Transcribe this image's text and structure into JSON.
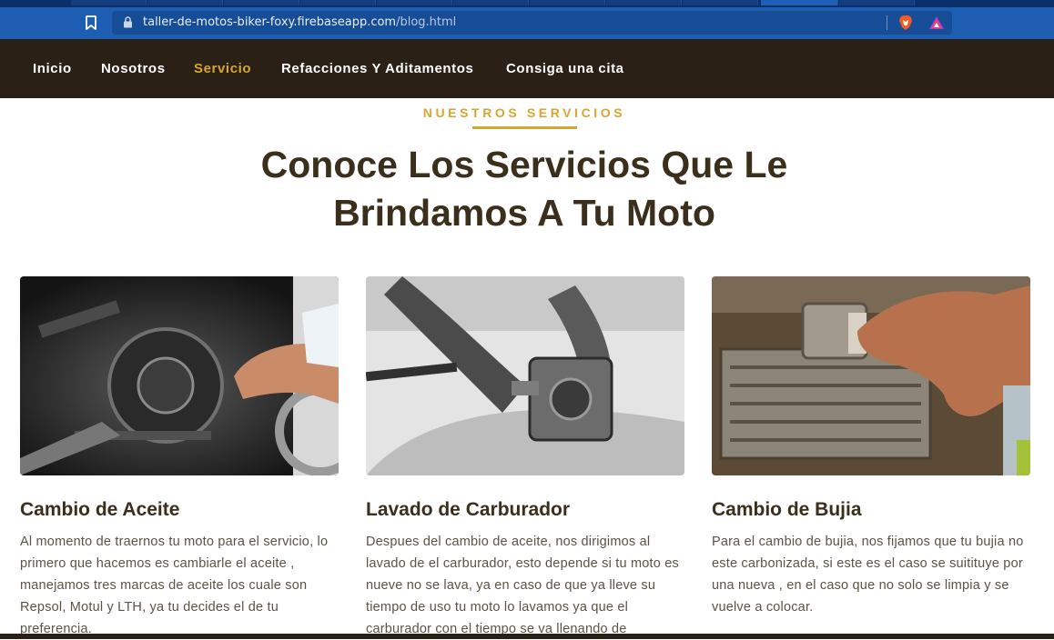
{
  "browser": {
    "url_host": "taller-de-motos-biker-foxy.firebaseapp.com",
    "url_path": "/blog.html",
    "icons": [
      "bookmark-icon",
      "lock-icon",
      "brave-shield-icon",
      "brave-rewards-icon"
    ]
  },
  "nav": {
    "items": [
      "Inicio",
      "Nosotros",
      "Servicio",
      "Refacciones Y Aditamentos",
      "Consiga una cita"
    ],
    "active": "Servicio"
  },
  "section": {
    "eyebrow": "NUESTROS SERVICIOS",
    "headline_line1": "Conoce Los Servicios Que Le",
    "headline_line2": "Brindamos A Tu Moto"
  },
  "cards": [
    {
      "title": "Cambio de Aceite",
      "text": "Al momento de traernos tu moto para el servicio, lo primero que hacemos es cambiarle el aceite , manejamos tres marcas de aceite los cuale son Repsol, Motul y LTH, ya tu decides el de tu preferencia."
    },
    {
      "title": "Lavado de Carburador",
      "text": "Despues del cambio de aceite, nos dirigimos al lavado de el carburador, esto depende si tu moto es nueve no se lava, ya en caso de que ya lleve su tiempo de uso tu moto lo lavamos ya que el carburador con el tiempo se va llenando de"
    },
    {
      "title": "Cambio de Bujia",
      "text": "Para el cambio de bujia, nos fijamos que tu bujia no este carbonizada, si este es el caso se suitituye por una nueva , en el caso que no solo se limpia y se vuelve a colocar."
    }
  ],
  "colors": {
    "accent": "#d9a530",
    "nav_bg": "#2a2016",
    "heading": "#3b2f1c",
    "body_text": "#5b5345",
    "browser_bar": "#1d5eb3"
  }
}
